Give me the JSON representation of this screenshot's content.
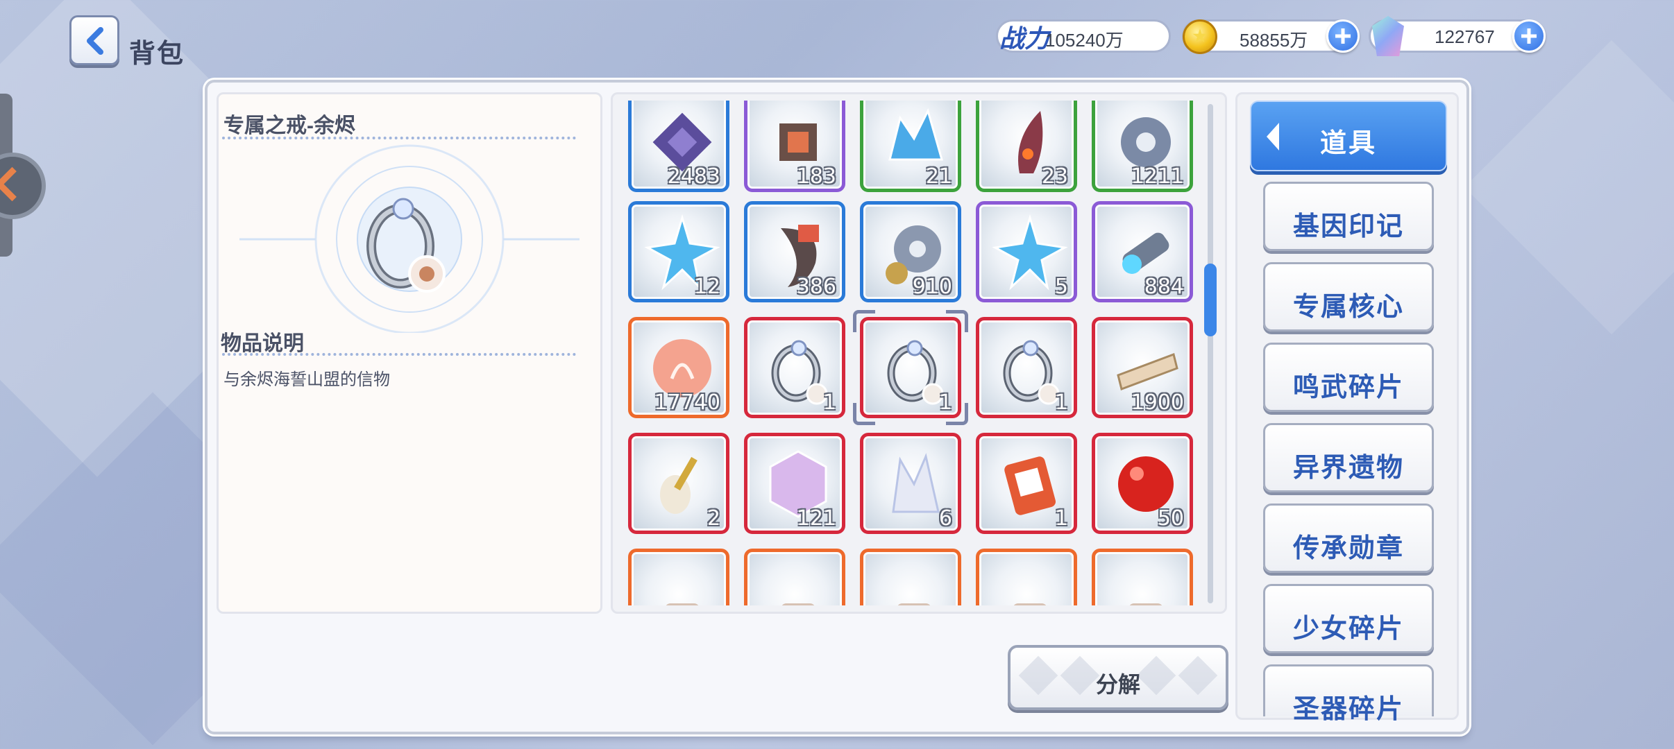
{
  "header": {
    "title": "背包",
    "power_label": "战力",
    "power_value": "105240万",
    "gold_value": "58855万",
    "gem_value": "122767"
  },
  "detail": {
    "item_name": "专属之戒-余烬",
    "desc_heading": "物品说明",
    "desc_text": "与余烬海誓山盟的信物"
  },
  "grid": {
    "items": [
      {
        "count": "2483",
        "rarity": "blue",
        "icon": "chip-cube-icon"
      },
      {
        "count": "183",
        "rarity": "purple",
        "icon": "circuit-chip-icon"
      },
      {
        "count": "21",
        "rarity": "green",
        "icon": "crystal-cluster-icon"
      },
      {
        "count": "23",
        "rarity": "green",
        "icon": "claw-shard-icon"
      },
      {
        "count": "1211",
        "rarity": "green",
        "icon": "gear-icon"
      },
      {
        "count": "12",
        "rarity": "blue",
        "icon": "star-crystal-icon"
      },
      {
        "count": "386",
        "rarity": "blue",
        "icon": "fang-icon"
      },
      {
        "count": "910",
        "rarity": "blue",
        "icon": "gears-icon"
      },
      {
        "count": "5",
        "rarity": "purple",
        "icon": "star-crystal-icon"
      },
      {
        "count": "884",
        "rarity": "purple",
        "icon": "drill-core-icon"
      },
      {
        "count": "17740",
        "rarity": "orange",
        "icon": "coral-orb-icon"
      },
      {
        "count": "1",
        "rarity": "red",
        "icon": "ring-icon"
      },
      {
        "count": "1",
        "rarity": "red",
        "icon": "ring-icon",
        "selected": true
      },
      {
        "count": "1",
        "rarity": "red",
        "icon": "ring-icon"
      },
      {
        "count": "1900",
        "rarity": "red",
        "icon": "scroll-icon"
      },
      {
        "count": "2",
        "rarity": "red",
        "icon": "lute-icon"
      },
      {
        "count": "121",
        "rarity": "red",
        "icon": "gem-icon"
      },
      {
        "count": "6",
        "rarity": "red",
        "icon": "crystal-shards-icon"
      },
      {
        "count": "1",
        "rarity": "red",
        "icon": "card-icon"
      },
      {
        "count": "50",
        "rarity": "red",
        "icon": "red-orb-icon"
      },
      {
        "count": "",
        "rarity": "orange",
        "icon": "item-icon"
      },
      {
        "count": "",
        "rarity": "orange",
        "icon": "item-icon"
      },
      {
        "count": "",
        "rarity": "orange",
        "icon": "item-icon"
      },
      {
        "count": "",
        "rarity": "orange",
        "icon": "item-icon"
      },
      {
        "count": "",
        "rarity": "orange",
        "icon": "item-icon"
      }
    ]
  },
  "actions": {
    "decompose_label": "分解"
  },
  "categories": {
    "active": "道具",
    "items": [
      "基因印记",
      "专属核心",
      "鸣武碎片",
      "异界遗物",
      "传承勋章",
      "少女碎片",
      "圣器碎片"
    ]
  },
  "colors": {
    "accent_blue": "#2f78e0",
    "rarity_blue": "#2a7ad8",
    "rarity_purple": "#8b5ad6",
    "rarity_green": "#3ca23c",
    "rarity_red": "#d6283c",
    "rarity_orange": "#ee6a2c"
  }
}
